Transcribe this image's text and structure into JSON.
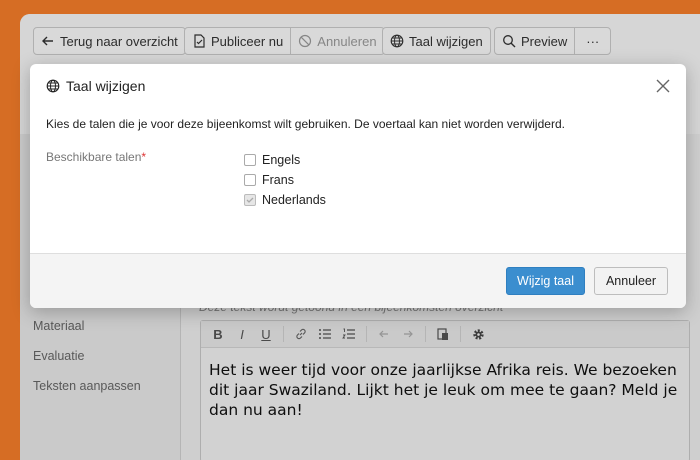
{
  "toolbar": {
    "back_label": "Terug naar overzicht",
    "publish_label": "Publiceer nu",
    "cancel_label": "Annuleren",
    "language_label": "Taal wijzigen",
    "preview_label": "Preview",
    "more_label": "···"
  },
  "sidebar": {
    "items": [
      {
        "label": "Materiaal"
      },
      {
        "label": "Evaluatie"
      },
      {
        "label": "Teksten aanpassen"
      }
    ]
  },
  "editor": {
    "hint": "Deze tekst wordt getoond in een bijeenkomsten overzicht",
    "toolbar": {
      "bold": "B",
      "italic": "I",
      "underline": "U"
    },
    "text": "Het is weer tijd voor onze jaarlijkse Afrika reis. We bezoeken dit jaar Swaziland. Lijkt het je leuk om mee te gaan? Meld je dan nu aan!"
  },
  "modal": {
    "title": "Taal wijzigen",
    "description": "Kies de talen die je voor deze bijeenkomst wilt gebruiken. De voertaal kan niet worden verwijderd.",
    "field_label": "Beschikbare talen",
    "required_mark": "*",
    "options": [
      {
        "label": "Engels",
        "checked": false,
        "disabled": false
      },
      {
        "label": "Frans",
        "checked": false,
        "disabled": false
      },
      {
        "label": "Nederlands",
        "checked": true,
        "disabled": true
      }
    ],
    "confirm_label": "Wijzig taal",
    "cancel_label": "Annuleer"
  },
  "colors": {
    "background": "#f47d2a",
    "primary": "#3b8ecf",
    "required": "#dd3333"
  }
}
